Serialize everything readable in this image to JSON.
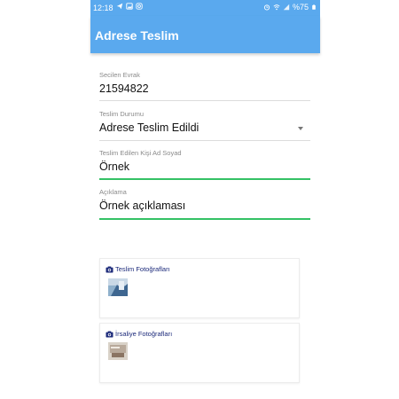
{
  "status_bar": {
    "time": "12:18",
    "battery": "%75"
  },
  "app_bar": {
    "title": "Adrese Teslim"
  },
  "form": {
    "selected_doc": {
      "label": "Secilen Evrak",
      "value": "21594822"
    },
    "delivery_status": {
      "label": "Teslim Durumu",
      "value": "Adrese Teslim Edildi"
    },
    "recipient_name": {
      "label": "Teslim Edilen Kişi Ad Soyad",
      "value": "Örnek"
    },
    "description": {
      "label": "Açıklama",
      "value": "Örnek açıklaması"
    }
  },
  "photo_sections": [
    {
      "title": "Teslim Fotoğrafları",
      "icon": "camera-icon"
    },
    {
      "title": "İrsaliye Fotoğrafları",
      "icon": "camera-icon"
    }
  ],
  "colors": {
    "primary": "#5aa9ee",
    "focus_underline": "#34c165",
    "section_title": "#1c2a7a"
  }
}
